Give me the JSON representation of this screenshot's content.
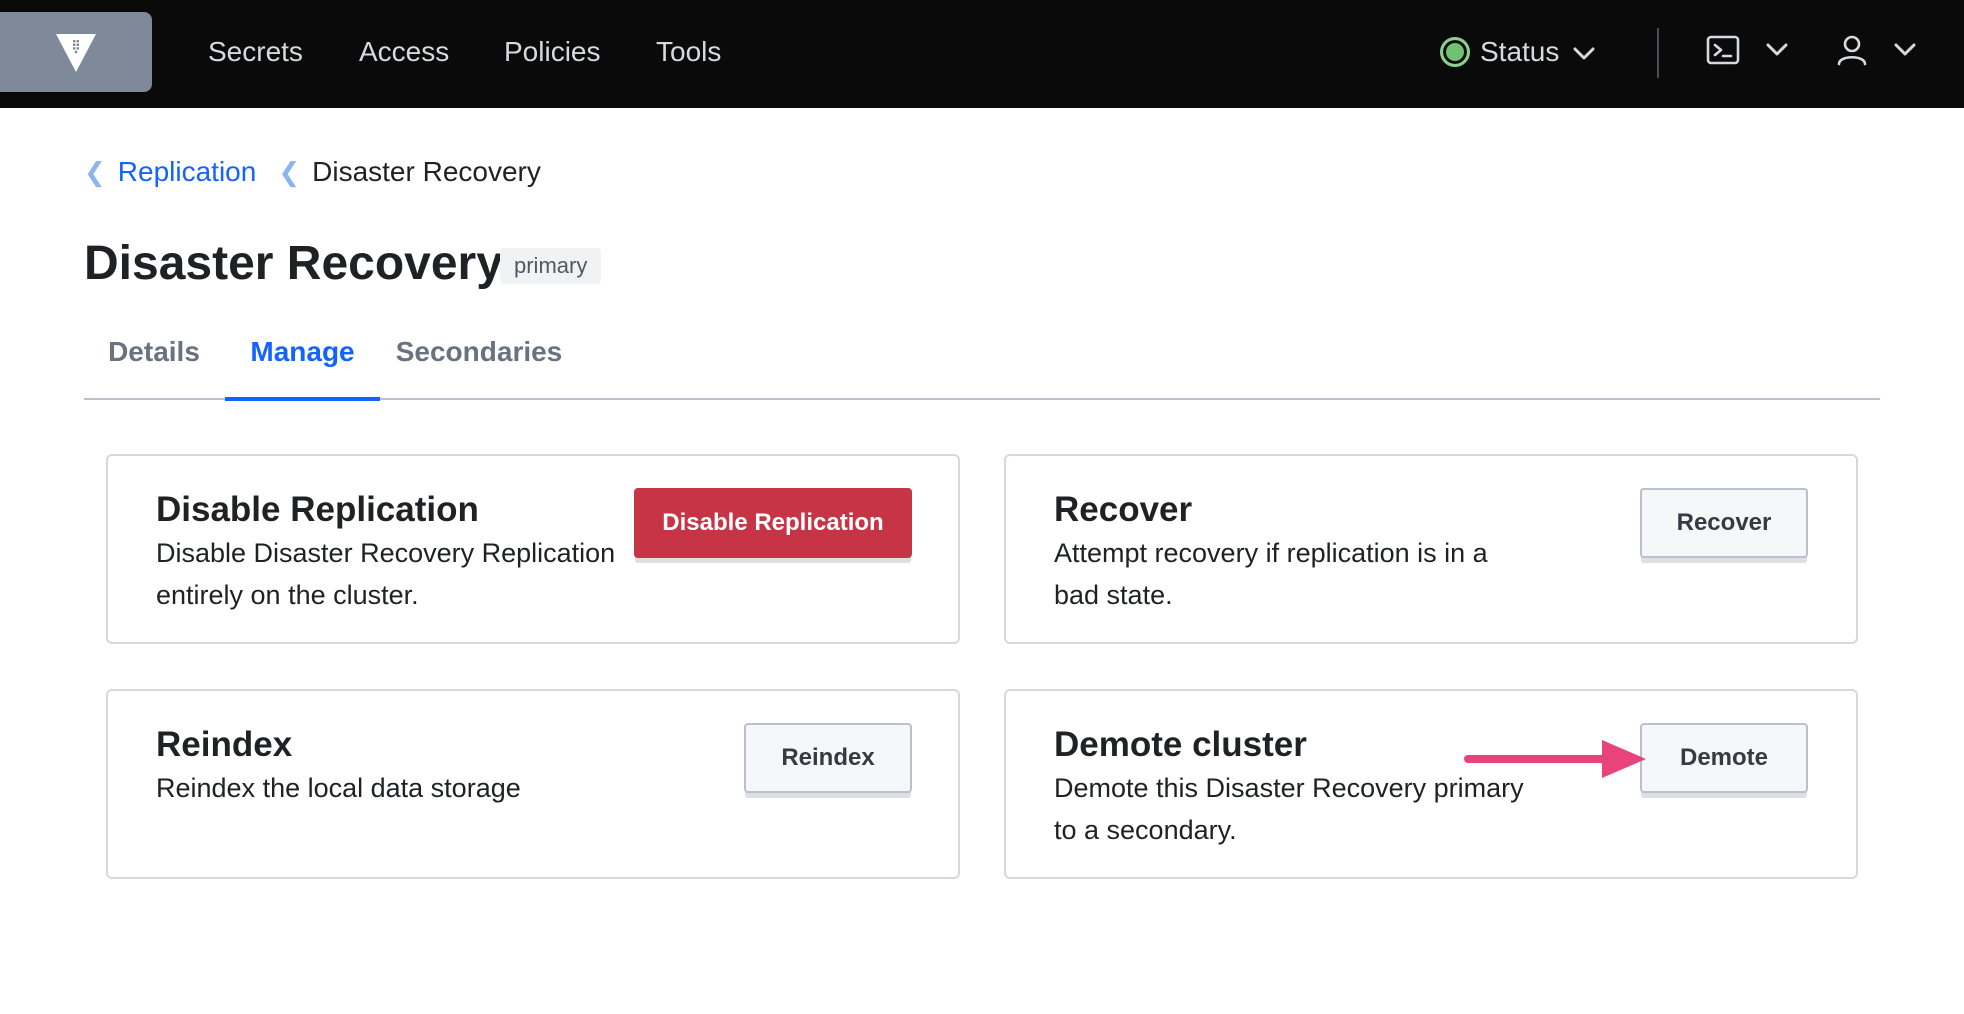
{
  "nav": {
    "links": [
      "Secrets",
      "Access",
      "Policies",
      "Tools"
    ],
    "status_label": "Status",
    "status_color": "#6cc26f",
    "icons": {
      "logo": "vault-logo-icon",
      "terminal": "terminal-icon",
      "user": "user-icon",
      "chevron": "chevron-down-icon"
    }
  },
  "breadcrumb": {
    "parent": "Replication",
    "current": "Disaster Recovery"
  },
  "page": {
    "title": "Disaster Recovery",
    "badge": "primary"
  },
  "tabs": [
    {
      "label": "Details",
      "active": false
    },
    {
      "label": "Manage",
      "active": true
    },
    {
      "label": "Secondaries",
      "active": false
    }
  ],
  "cards": {
    "disable": {
      "title": "Disable Replication",
      "description": "Disable Disaster Recovery Replication entirely on the cluster.",
      "button": "Disable Replication"
    },
    "recover": {
      "title": "Recover",
      "description": "Attempt recovery if replication is in a bad state.",
      "button": "Recover"
    },
    "reindex": {
      "title": "Reindex",
      "description": "Reindex the local data storage",
      "button": "Reindex"
    },
    "demote": {
      "title": "Demote cluster",
      "description": "Demote this Disaster Recovery primary to a secondary.",
      "button": "Demote"
    }
  },
  "colors": {
    "accent": "#1563ff",
    "danger": "#c73445",
    "annotation_arrow": "#e8437a"
  }
}
